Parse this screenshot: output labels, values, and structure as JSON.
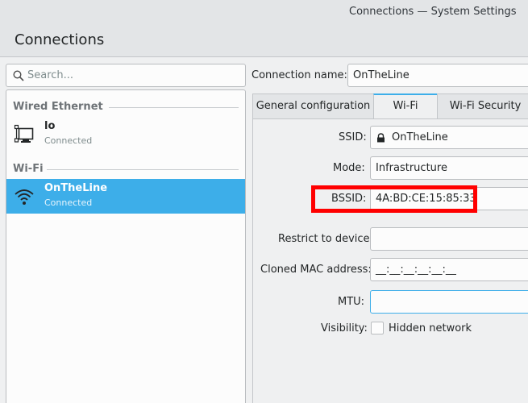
{
  "window": {
    "title": "Connections — System Settings"
  },
  "header": {
    "title": "Connections"
  },
  "search": {
    "placeholder": "Search..."
  },
  "sidebar": {
    "sections": [
      {
        "title": "Wired Ethernet",
        "items": [
          {
            "name": "lo",
            "status": "Connected",
            "icon": "wired-network-icon"
          }
        ]
      },
      {
        "title": "Wi-Fi",
        "items": [
          {
            "name": "OnTheLine",
            "status": "Connected",
            "icon": "wifi-icon",
            "selected": true
          }
        ]
      }
    ]
  },
  "details": {
    "connection_name_label": "Connection name:",
    "connection_name_value": "OnTheLine",
    "tabs": [
      {
        "label": "General configuration"
      },
      {
        "label": "Wi-Fi",
        "active": true
      },
      {
        "label": "Wi-Fi Security"
      }
    ],
    "fields": {
      "ssid_label": "SSID:",
      "ssid_value": "OnTheLine",
      "mode_label": "Mode:",
      "mode_value": "Infrastructure",
      "bssid_label": "BSSID:",
      "bssid_value": "4A:BD:CE:15:85:33",
      "restrict_label": "Restrict to device:",
      "restrict_value": "",
      "cloned_mac_label": "Cloned MAC address:",
      "cloned_mac_value": "__:__:__:__:__:__",
      "mtu_label": "MTU:",
      "mtu_value": "",
      "visibility_label": "Visibility:",
      "hidden_network_label": "Hidden network"
    }
  },
  "colors": {
    "accent": "#3daee9",
    "highlight": "#ff0000",
    "window_bg": "#eff0f1"
  }
}
